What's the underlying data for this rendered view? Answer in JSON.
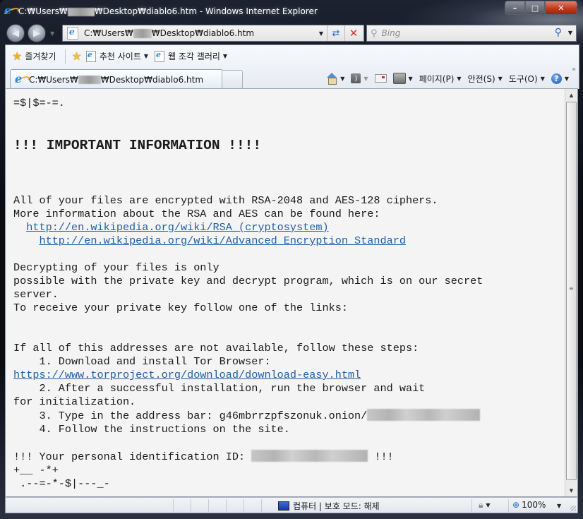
{
  "window": {
    "title_prefix": "C:₩Users₩",
    "title_suffix": "₩Desktop₩diablo6.htm - Windows Internet Explorer",
    "controls": {
      "minimize": "–",
      "maximize": "□",
      "close": "✕"
    }
  },
  "nav": {
    "back": "◀",
    "forward": "▶",
    "address_prefix": "C:₩Users₩",
    "address_suffix": "₩Desktop₩diablo6.htm",
    "search_placeholder": "Bing"
  },
  "favorites_bar": {
    "favorites_label": "즐겨찾기",
    "items": [
      {
        "label": "추천 사이트"
      },
      {
        "label": "웹 조각 갤러리"
      }
    ]
  },
  "tab": {
    "title_prefix": "C:₩Users₩",
    "title_suffix": "₩Desktop₩diablo6.htm"
  },
  "command_bar": {
    "page_label": "페이지(P)",
    "safety_label": "안전(S)",
    "tools_label": "도구(O)",
    "help_label": "?",
    "more": "»"
  },
  "content": {
    "deco_top": "=$|$=-=.",
    "heading": "!!! IMPORTANT INFORMATION !!!!",
    "p1_line1": "All of your files are encrypted with RSA-2048 and AES-128 ciphers.",
    "p1_line2": "More information about the RSA and AES can be found here:",
    "link_rsa": "http://en.wikipedia.org/wiki/RSA_(cryptosystem)",
    "link_aes": "http://en.wikipedia.org/wiki/Advanced_Encryption_Standard",
    "p2_line1": "Decrypting of your files is only",
    "p2_line2": "possible with the private key and decrypt program, which is on our secret",
    "p2_line3": "server.",
    "p2_line4": "To receive your private key follow one of the links:",
    "p3_line1": "If all of this addresses are not available, follow these steps:",
    "step1": "    1. Download and install Tor Browser:",
    "link_tor": "https://www.torproject.org/download/download-easy.html",
    "step2a": "    2. After a successful installation, run the browser and wait",
    "step2b": "for initialization.",
    "step3": "    3. Type in the address bar: g46mbrrzpfszonuk.onion/",
    "step4": "    4. Follow the instructions on the site.",
    "id_prefix": "!!! Your personal identification ID: ",
    "id_suffix": " !!!",
    "deco_bottom1": "+__ -*+",
    "deco_bottom2": " .--=-*-$|---_-"
  },
  "status_bar": {
    "zone_label": "컴퓨터 | 보호 모드: 해제",
    "zoom_label": "100%"
  }
}
